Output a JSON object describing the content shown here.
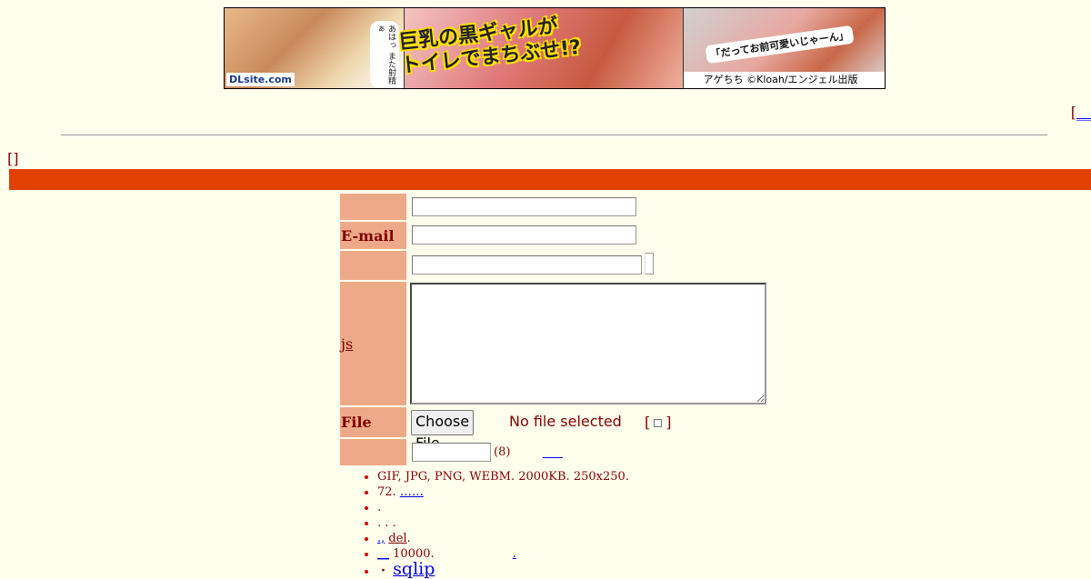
{
  "banner": {
    "logo": "DLsite.com",
    "vertical_text": "あはっ また射精ぁ",
    "catch_line1": "巨乳の黒ギャルが",
    "catch_line2": "トイレでまちぶせ!?",
    "quote": "「だってお前可愛いじゃーん」",
    "credit": "アゲちち ©Kloah/エンジェル出版"
  },
  "top_right": {
    "bracket": "[",
    "link_text": "__"
  },
  "mode_bracket": "[]",
  "form": {
    "labels": {
      "name": "",
      "email": "E-mail",
      "subject": "",
      "comment_link": "js",
      "file": "File",
      "password": ""
    },
    "inputs": {
      "name_value": "",
      "email_value": "",
      "subject_value": "",
      "comment_value": "",
      "password_value": ""
    },
    "file_button": "Choose File",
    "file_status": "No file selected",
    "textonly_open": "[",
    "textonly_close": "]",
    "password_hint": "(8)"
  },
  "rules": [
    {
      "text": "GIF, JPG, PNG, WEBM. 2000KB. 250x250."
    },
    {
      "text": "72.",
      "link": "……"
    },
    {
      "text": "."
    },
    {
      "text": ". . ."
    },
    {
      "link": ".,",
      "text_link": "del",
      "suffix": "."
    },
    {
      "link": "__",
      "text": " 10000.",
      "tail_link": "."
    },
    {
      "lead": "・",
      "link": "sqlip"
    }
  ]
}
